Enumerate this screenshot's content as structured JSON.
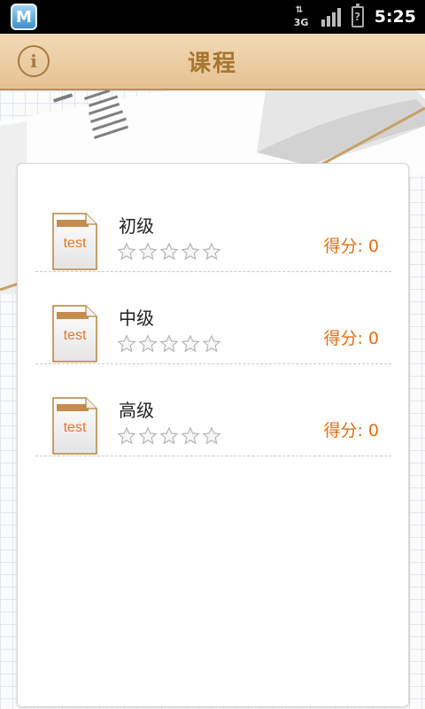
{
  "status_bar": {
    "app_icon_letter": "M",
    "network": "3G",
    "battery_symbol": "?",
    "time": "5:25"
  },
  "header": {
    "title": "课程",
    "info_icon": "i"
  },
  "courses": [
    {
      "name": "初级",
      "icon_label": "test",
      "stars_filled": 0,
      "stars_total": 5,
      "score_text": "得分: 0"
    },
    {
      "name": "中级",
      "icon_label": "test",
      "stars_filled": 0,
      "stars_total": 5,
      "score_text": "得分: 0"
    },
    {
      "name": "高级",
      "icon_label": "test",
      "stars_filled": 0,
      "stars_total": 5,
      "score_text": "得分: 0"
    }
  ],
  "colors": {
    "accent": "#e46e12",
    "title": "#a87531",
    "header_bg": "#f2d9b5"
  }
}
